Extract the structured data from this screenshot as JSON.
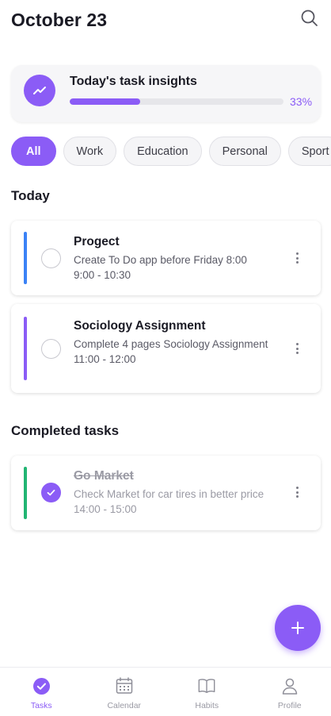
{
  "header": {
    "title": "October 23"
  },
  "insights": {
    "label": "Today's task insights",
    "progress_percent_text": "33%",
    "progress": 0.33
  },
  "filters": [
    "All",
    "Work",
    "Education",
    "Personal",
    "Sport"
  ],
  "sections": {
    "today": "Today",
    "completed": "Completed tasks"
  },
  "tasks_today": [
    {
      "name": "Progect",
      "description": "Create To Do app before Friday 8:00",
      "time": "9:00 - 10:30",
      "color": "#3b82f6"
    },
    {
      "name": "Sociology Assignment",
      "description": "Complete 4 pages Sociology Assignment",
      "time": "11:00 - 12:00",
      "color": "#8b5cf6"
    }
  ],
  "tasks_completed": [
    {
      "name": "Go Market",
      "description": "Check Market for car tires in better price",
      "time": "14:00 - 15:00",
      "color": "#22b573"
    }
  ],
  "tabs": [
    {
      "label": "Tasks",
      "icon": "tasks-check-icon",
      "active": true
    },
    {
      "label": "Calendar",
      "icon": "calendar-icon",
      "active": false
    },
    {
      "label": "Habits",
      "icon": "book-icon",
      "active": false
    },
    {
      "label": "Profile",
      "icon": "profile-icon",
      "active": false
    }
  ],
  "colors": {
    "accent": "#8b5cf6",
    "work": "#3b82f6",
    "done": "#22b573"
  }
}
